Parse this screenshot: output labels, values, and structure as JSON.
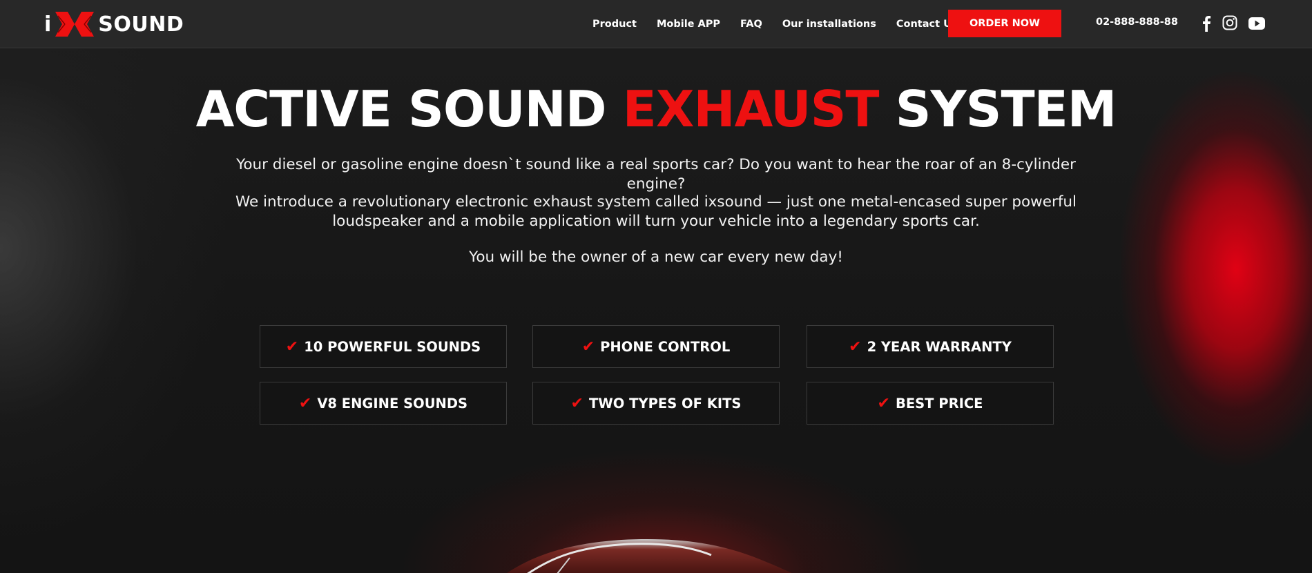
{
  "header": {
    "logo": {
      "prefix": "i",
      "name": "SOUND"
    },
    "nav": [
      "Product",
      "Mobile APP",
      "FAQ",
      "Our installations",
      "Contact Us"
    ],
    "order_button": "ORDER NOW",
    "phone": "02-888-888-88",
    "social_icons": [
      "facebook-icon",
      "instagram-icon",
      "youtube-icon"
    ]
  },
  "hero": {
    "title_part1": "ACTIVE SOUND ",
    "title_accent": "EXHAUST",
    "title_part2": " SYSTEM",
    "paragraph1": "Your diesel or gasoline engine doesn`t sound like a real sports car? Do you want to hear the roar of an 8-cylinder engine?",
    "paragraph2": "We introduce a revolutionary electronic exhaust system called ixsound — just one metal-encased super powerful loudspeaker and a mobile application will turn your vehicle into a legendary sports car.",
    "paragraph3": "You will be the owner of a new car every new day!"
  },
  "features": [
    "10 POWERFUL SOUNDS",
    "PHONE CONTROL",
    "2 YEAR WARRANTY",
    "V8 ENGINE SOUNDS",
    "TWO TYPES OF KITS",
    "BEST PRICE"
  ],
  "colors": {
    "accent": "#ee1111",
    "header_bg": "#282828",
    "page_bg": "#151515"
  }
}
